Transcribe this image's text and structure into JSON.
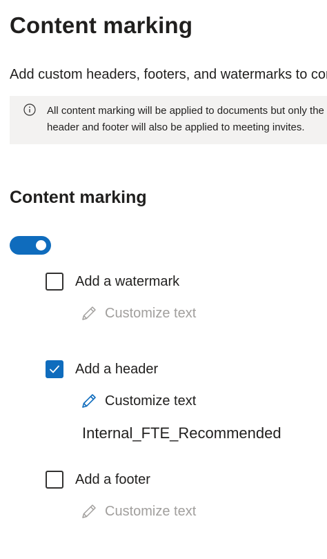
{
  "page": {
    "title": "Content marking",
    "description": "Add custom headers, footers, and watermarks to content that has this label applied.",
    "info": {
      "icon": "info-icon",
      "line1": "All content marking will be applied to documents but only the",
      "line2": "header and footer will also be applied to meeting invites."
    }
  },
  "section": {
    "title": "Content marking",
    "toggle_on": true,
    "accent_color": "#0f6cbd"
  },
  "options": {
    "watermark": {
      "label": "Add a watermark",
      "checked": false,
      "customize_label": "Customize text",
      "customize_enabled": false
    },
    "header": {
      "label": "Add a header",
      "checked": true,
      "customize_label": "Customize text",
      "customize_enabled": true,
      "value": "Internal_FTE_Recommended"
    },
    "footer": {
      "label": "Add a footer",
      "checked": false,
      "customize_label": "Customize text",
      "customize_enabled": false
    }
  }
}
